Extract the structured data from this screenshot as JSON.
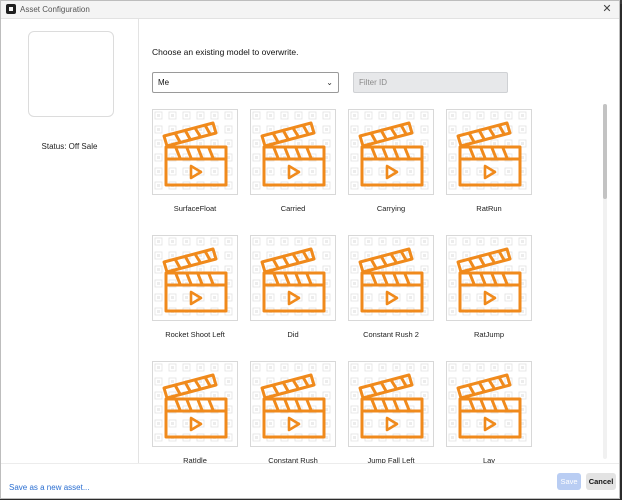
{
  "window": {
    "title": "Asset Configuration"
  },
  "sidebar": {
    "status": "Status: Off Sale"
  },
  "main": {
    "heading": "Choose an existing model to overwrite.",
    "owner_select": {
      "value": "Me"
    },
    "filter": {
      "placeholder": "Filter ID"
    }
  },
  "assets": [
    {
      "label": "SurfaceFloat"
    },
    {
      "label": "Carried"
    },
    {
      "label": "Carrying"
    },
    {
      "label": "RatRun"
    },
    {
      "label": "Rocket Shoot Left"
    },
    {
      "label": "Did"
    },
    {
      "label": "Constant Rush 2"
    },
    {
      "label": "RatJump"
    },
    {
      "label": "RatIdle"
    },
    {
      "label": "Constant Rush"
    },
    {
      "label": "Jump Fall Left"
    },
    {
      "label": "Lay"
    }
  ],
  "footer": {
    "save_new": "Save as a new asset...",
    "save": "Save",
    "cancel": "Cancel"
  },
  "colors": {
    "accent_orange": "#f08a1c",
    "link_blue": "#2a6ed1"
  }
}
